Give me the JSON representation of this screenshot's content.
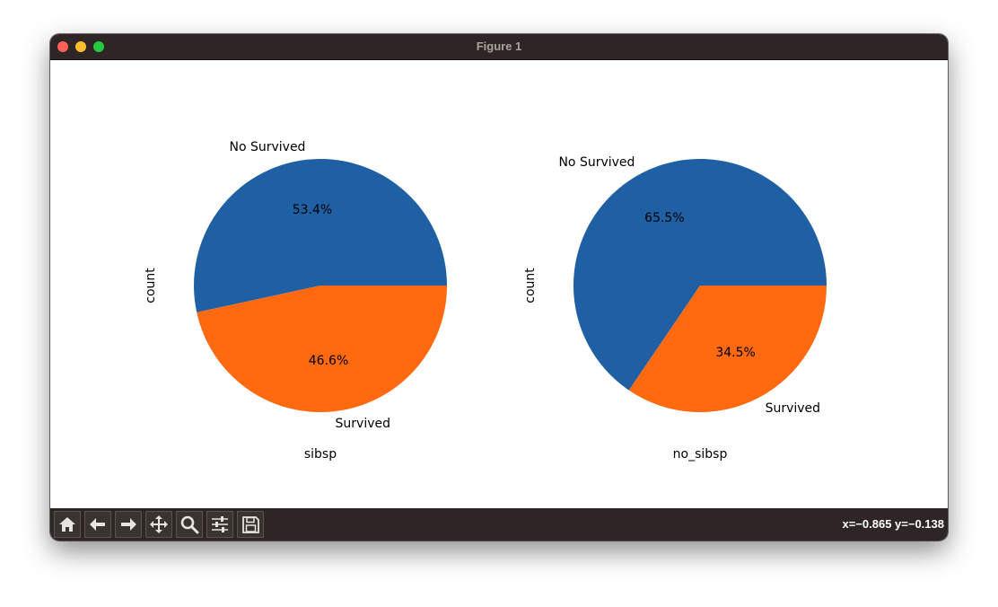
{
  "window": {
    "title": "Figure 1"
  },
  "toolbar": {
    "buttons": [
      "home",
      "back",
      "forward",
      "pan",
      "zoom",
      "configure-subplots",
      "save"
    ],
    "coords": "x=−0.865 y=−0.138"
  },
  "colors": {
    "blue": "#1f5fa3",
    "orange": "#ff6a11"
  },
  "chart_data": [
    {
      "type": "pie",
      "title": "",
      "xlabel": "sibsp",
      "ylabel": "count",
      "labels": [
        "No Survived",
        "Survived"
      ],
      "values": [
        53.4,
        46.6
      ],
      "value_labels": [
        "53.4%",
        "46.6%"
      ]
    },
    {
      "type": "pie",
      "title": "",
      "xlabel": "no_sibsp",
      "ylabel": "count",
      "labels": [
        "No Survived",
        "Survived"
      ],
      "values": [
        65.5,
        34.5
      ],
      "value_labels": [
        "65.5%",
        "34.5%"
      ]
    }
  ]
}
